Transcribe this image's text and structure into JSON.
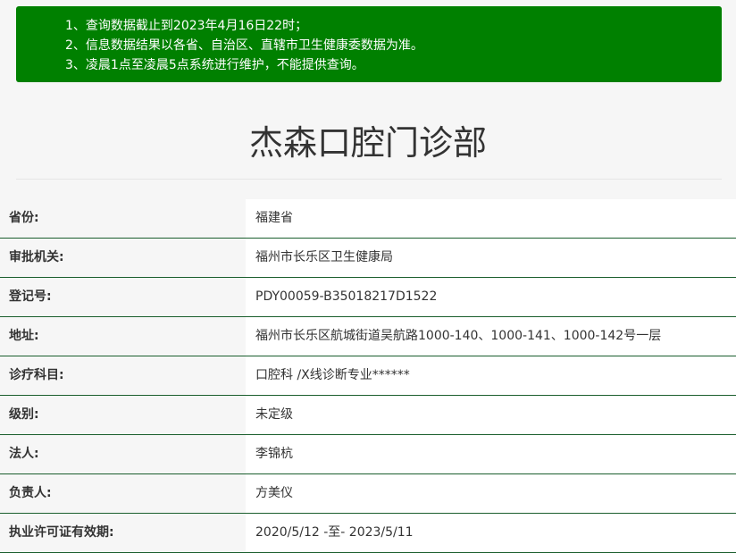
{
  "notice": {
    "lines": [
      "1、查询数据截止到2023年4月16日22时；",
      "2、信息数据结果以各省、自治区、直辖市卫生健康委数据为准。",
      "3、凌晨1点至凌晨5点系统进行维护，不能提供查询。"
    ]
  },
  "title": "杰森口腔门诊部",
  "rows": [
    {
      "label": "省份:",
      "value": "福建省"
    },
    {
      "label": "审批机关:",
      "value": "福州市长乐区卫生健康局"
    },
    {
      "label": "登记号:",
      "value": "PDY00059-B35018217D1522"
    },
    {
      "label": "地址:",
      "value": "福州市长乐区航城街道吴航路1000-140、1000-141、1000-142号一层"
    },
    {
      "label": "诊疗科目:",
      "value": "口腔科 /X线诊断专业******"
    },
    {
      "label": "级别:",
      "value": "未定级"
    },
    {
      "label": "法人:",
      "value": "李锦杭"
    },
    {
      "label": "负责人:",
      "value": "方美仪"
    },
    {
      "label": "执业许可证有效期:",
      "value": "2020/5/12 -至- 2023/5/11"
    }
  ],
  "colors": {
    "notice_bg": "#008000",
    "row_border": "#1a5e2d"
  }
}
